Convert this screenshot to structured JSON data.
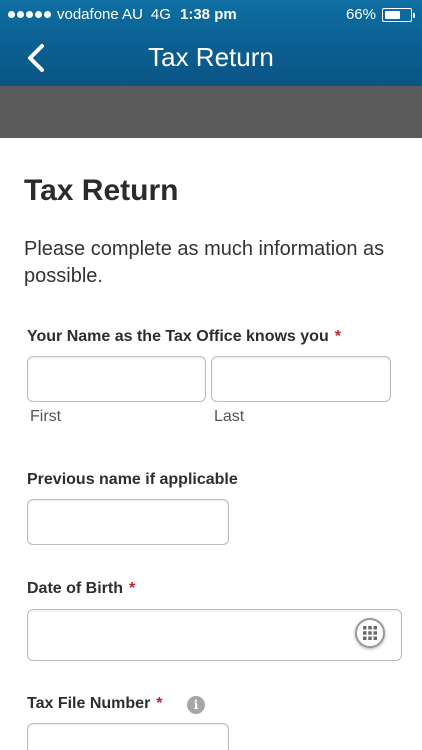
{
  "status_bar": {
    "carrier": "vodafone AU",
    "network": "4G",
    "time": "1:38 pm",
    "battery_percent_label": "66%",
    "battery_level": 0.66
  },
  "nav": {
    "title": "Tax Return",
    "back_icon": "chevron-left-icon"
  },
  "form": {
    "title": "Tax Return",
    "intro": "Please complete as much information as possible.",
    "name_section": {
      "label": "Your Name as the Tax Office knows you",
      "required_marker": "*",
      "first": {
        "value": "",
        "sublabel": "First"
      },
      "last": {
        "value": "",
        "sublabel": "Last"
      }
    },
    "previous_name": {
      "label": "Previous name if applicable",
      "value": ""
    },
    "date_of_birth": {
      "label": "Date of Birth",
      "required_marker": "*",
      "value": "",
      "calendar_icon": "calendar-grid-icon"
    },
    "tax_file_number": {
      "label": "Tax File Number",
      "required_marker": "*",
      "info_icon": "info-icon",
      "info_glyph": "i"
    }
  },
  "colors": {
    "header_blue": "#0b5f90",
    "required_red": "#c0202a",
    "band_gray": "#5b5b5b"
  }
}
